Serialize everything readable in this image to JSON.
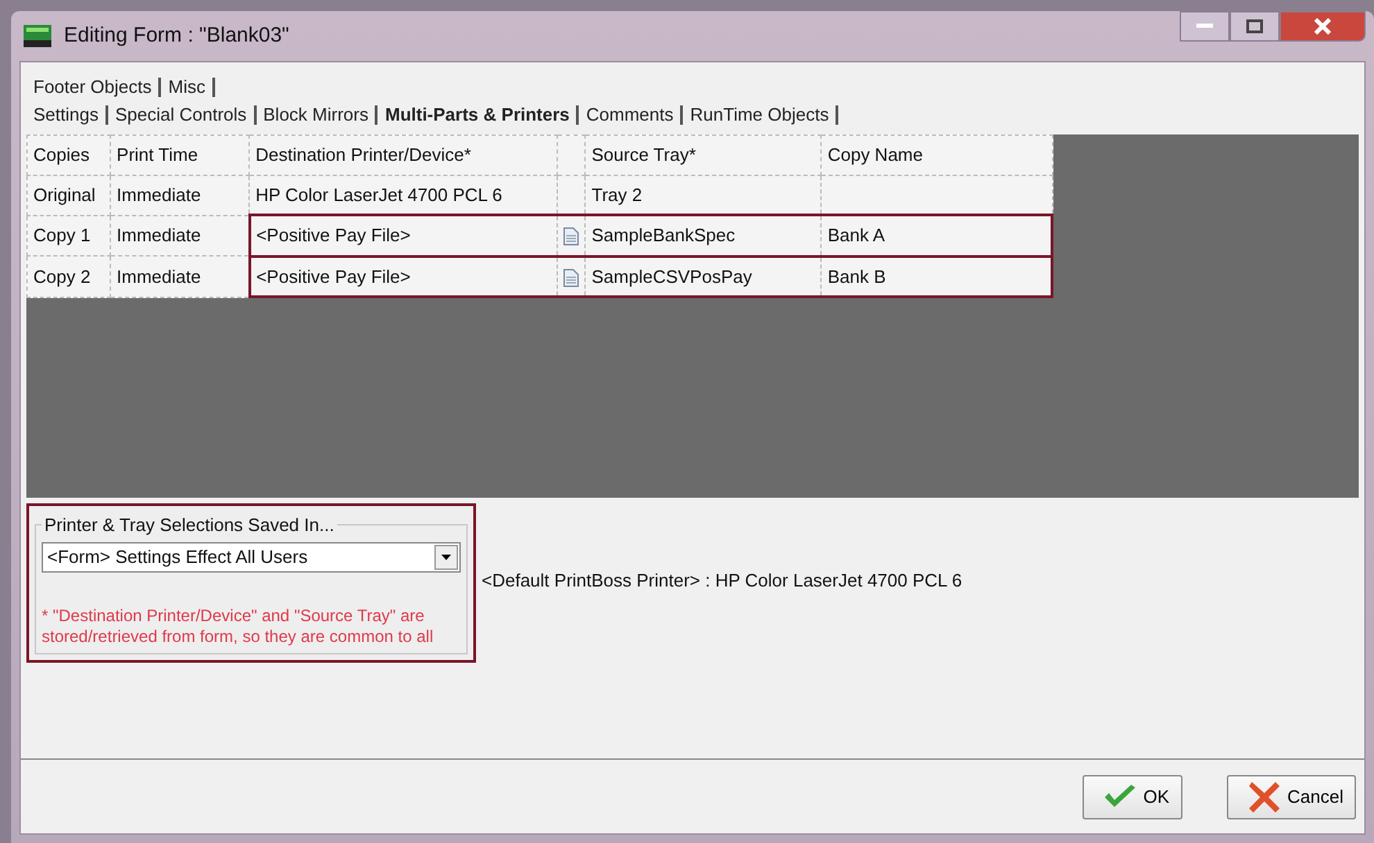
{
  "window": {
    "title": "Editing Form : \"Blank03\""
  },
  "tab_rows": [
    [
      {
        "label": "Footer Objects",
        "selected": false
      },
      {
        "label": "Misc",
        "selected": false
      }
    ],
    [
      {
        "label": "Settings",
        "selected": false
      },
      {
        "label": "Special Controls",
        "selected": false
      },
      {
        "label": "Block Mirrors",
        "selected": false
      },
      {
        "label": "Multi-Parts & Printers",
        "selected": true
      },
      {
        "label": "Comments",
        "selected": false
      },
      {
        "label": "RunTime Objects",
        "selected": false
      }
    ]
  ],
  "table": {
    "columns": [
      "Copies",
      "Print Time",
      "Destination Printer/Device*",
      "Source Tray*",
      "Copy Name"
    ],
    "rows": [
      {
        "copies": "Original",
        "print_time": "Immediate",
        "destination": "HP Color LaserJet 4700 PCL 6",
        "kind": "tray",
        "source": "Tray 2",
        "highlighted": false
      },
      {
        "copies": "Copy 1",
        "print_time": "Immediate",
        "destination": "<Positive Pay File>",
        "kind": "file",
        "source": "SampleBankSpec",
        "copy_name": "Bank A",
        "highlighted": true
      },
      {
        "copies": "Copy 2",
        "print_time": "Immediate",
        "destination": "<Positive Pay File>",
        "kind": "file",
        "source": "SampleCSVPosPay",
        "copy_name": "Bank B",
        "highlighted": true
      }
    ]
  },
  "saved_in": {
    "title": "Printer & Tray Selections Saved In...",
    "value": "<Form> Settings Effect All Users",
    "note": "* \"Destination Printer/Device\" and \"Source Tray\" are stored/retrieved from form, so they are common to all"
  },
  "default_printer": "<Default PrintBoss Printer> : HP Color LaserJet 4700 PCL 6",
  "buttons": [
    {
      "kind": "ok",
      "label": "OK"
    },
    {
      "kind": "cancel",
      "label": "Cancel"
    }
  ]
}
